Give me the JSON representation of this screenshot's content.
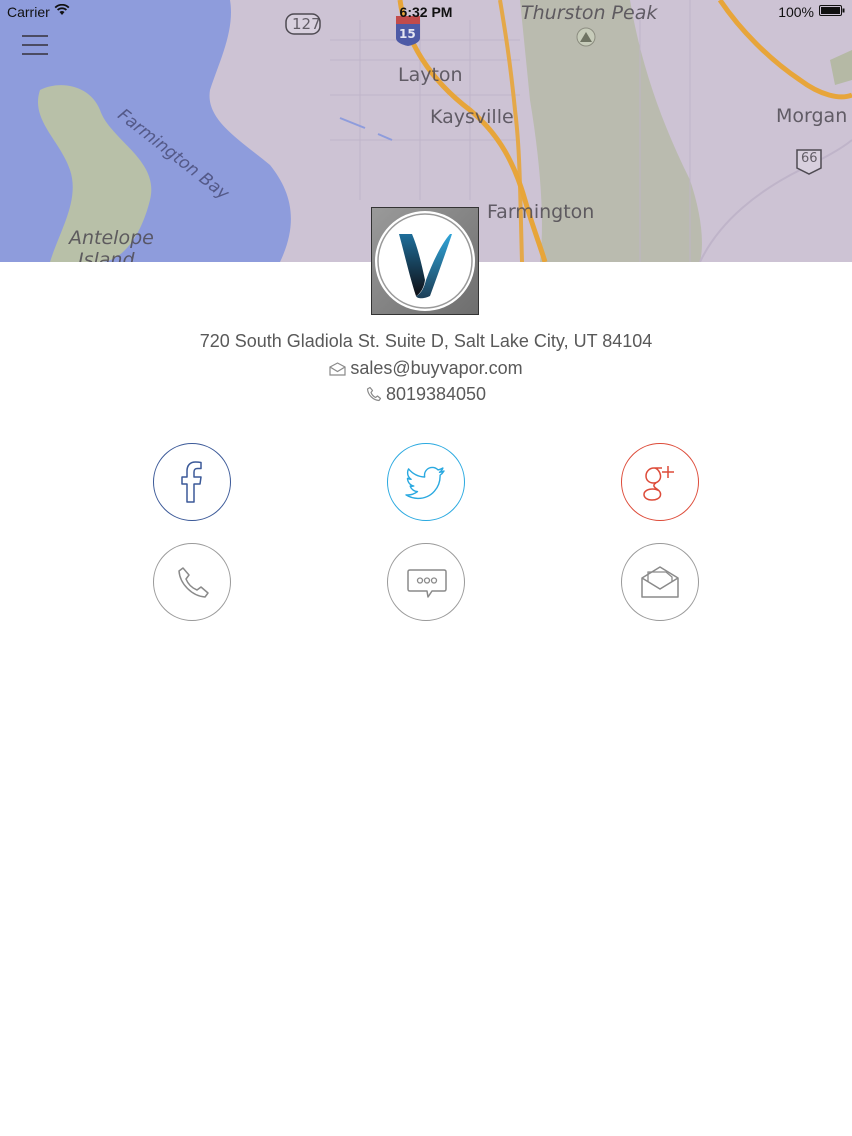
{
  "status_bar": {
    "carrier": "Carrier",
    "time": "6:32 PM",
    "battery": "100%",
    "wifi_icon": "wifi-icon",
    "battery_icon": "battery-icon"
  },
  "map": {
    "labels": {
      "thurston_peak": "Thurston Peak",
      "layton": "Layton",
      "kaysville": "Kaysville",
      "morgan": "Morgan",
      "farmington_bay": "Farmington Bay",
      "farmington": "Farmington",
      "antelope": "Antelope",
      "island": "Island",
      "route_127": "127",
      "route_15": "15",
      "route_66": "66"
    }
  },
  "header": {
    "menu_icon": "hamburger-menu-icon"
  },
  "business": {
    "logo": "vapor-logo",
    "address": "720 South Gladiola St. Suite D, Salt Lake City, UT  84104",
    "email": "sales@buyvapor.com",
    "phone": "8019384050"
  },
  "actions": [
    {
      "name": "facebook",
      "icon": "facebook-icon",
      "color": "#3b5998"
    },
    {
      "name": "twitter",
      "icon": "twitter-icon",
      "color": "#2aa9e0"
    },
    {
      "name": "google-plus",
      "icon": "google-plus-icon",
      "color": "#dd4b39"
    },
    {
      "name": "call",
      "icon": "phone-icon",
      "color": "#9a9a9a"
    },
    {
      "name": "message",
      "icon": "chat-bubble-icon",
      "color": "#9a9a9a"
    },
    {
      "name": "email",
      "icon": "envelope-icon",
      "color": "#9a9a9a"
    }
  ],
  "colors": {
    "map_tint": "#c9bfd2",
    "water": "#8e9cdc",
    "highway": "#e7a53a",
    "text": "#595959"
  }
}
